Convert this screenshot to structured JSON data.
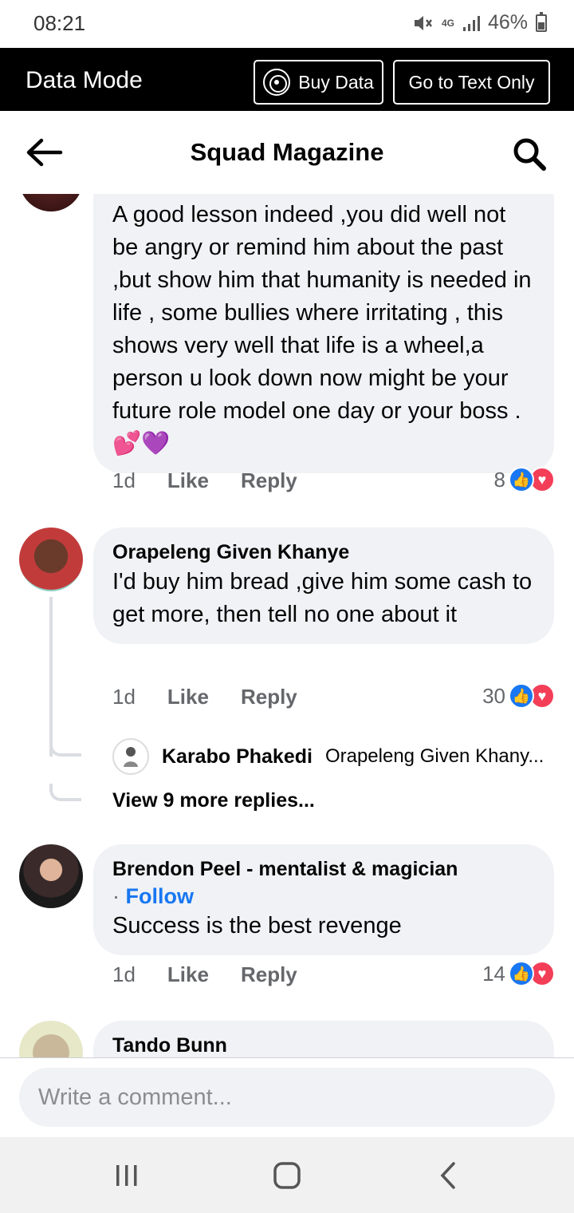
{
  "status_bar": {
    "time": "08:21",
    "network": "4G",
    "battery": "46%"
  },
  "data_mode": {
    "title": "Data Mode",
    "buy_data": "Buy Data",
    "text_only": "Go to Text Only"
  },
  "header": {
    "title": "Squad Magazine"
  },
  "comments": [
    {
      "text": "A good lesson indeed ,you did well not be angry or remind him about the past ,but show him that humanity is needed in life , some bullies where irritating , this shows very well that life is a wheel,a person u look down now might be your future role model one day or your boss  . 💕💜",
      "time": "1d",
      "like": "Like",
      "reply": "Reply",
      "reactions": "8"
    },
    {
      "author": "Orapeleng Given Khanye",
      "text": "I'd buy him bread ,give him some cash to get more, then tell no one about it",
      "time": "1d",
      "like": "Like",
      "reply": "Reply",
      "reactions": "30",
      "reply_preview": {
        "author": "Karabo Phakedi",
        "snippet": "Orapeleng Given Khany..."
      },
      "view_more": "View 9 more replies..."
    },
    {
      "author": "Brendon Peel - mentalist & magician",
      "follow_separator": "·",
      "follow": "Follow",
      "text": "Success is the best revenge",
      "time": "1d",
      "like": "Like",
      "reply": "Reply",
      "reactions": "14"
    },
    {
      "author": "Tando Bunn"
    }
  ],
  "composer": {
    "placeholder": "Write a comment..."
  },
  "colors": {
    "accent": "#1877f2",
    "bubble": "#f0f2f5",
    "muted": "#65676b",
    "love": "#f33e58"
  }
}
